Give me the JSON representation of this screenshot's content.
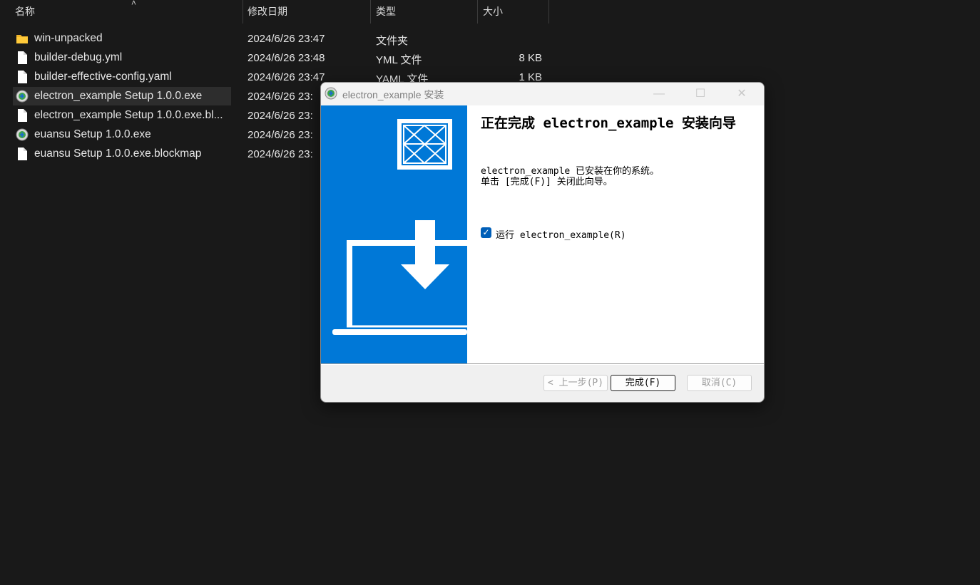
{
  "explorer": {
    "columns": {
      "name": "名称",
      "modified": "修改日期",
      "type": "类型",
      "size": "大小"
    },
    "files": [
      {
        "name": "win-unpacked",
        "date": "2024/6/26 23:47",
        "type": "文件夹",
        "size": "",
        "icon": "folder-icon"
      },
      {
        "name": "builder-debug.yml",
        "date": "2024/6/26 23:48",
        "type": "YML 文件",
        "size": "8 KB",
        "icon": "document-icon"
      },
      {
        "name": "builder-effective-config.yaml",
        "date": "2024/6/26 23:47",
        "type": "YAML 文件",
        "size": "1 KB",
        "icon": "document-icon"
      },
      {
        "name": "electron_example Setup 1.0.0.exe",
        "date": "2024/6/26 23:",
        "type": "",
        "size": "",
        "icon": "installer-icon",
        "selected": true
      },
      {
        "name": "electron_example Setup 1.0.0.exe.bl...",
        "date": "2024/6/26 23:",
        "type": "",
        "size": "",
        "icon": "document-icon"
      },
      {
        "name": "euansu Setup 1.0.0.exe",
        "date": "2024/6/26 23:",
        "type": "",
        "size": "",
        "icon": "installer-icon"
      },
      {
        "name": "euansu Setup 1.0.0.exe.blockmap",
        "date": "2024/6/26 23:",
        "type": "",
        "size": "",
        "icon": "document-icon"
      }
    ]
  },
  "dialog": {
    "title": "electron_example 安装",
    "heading": "正在完成 electron_example 安装向导",
    "message_line1": "electron_example 已安装在你的系统。",
    "message_line2": "单击 [完成(F)] 关闭此向导。",
    "run_checkbox_label": "运行 electron_example(R)",
    "run_checked": true,
    "back_label": "< 上一步(P)",
    "finish_label": "完成(F)",
    "cancel_label": "取消(C)",
    "banner_color": "#0078d7"
  }
}
